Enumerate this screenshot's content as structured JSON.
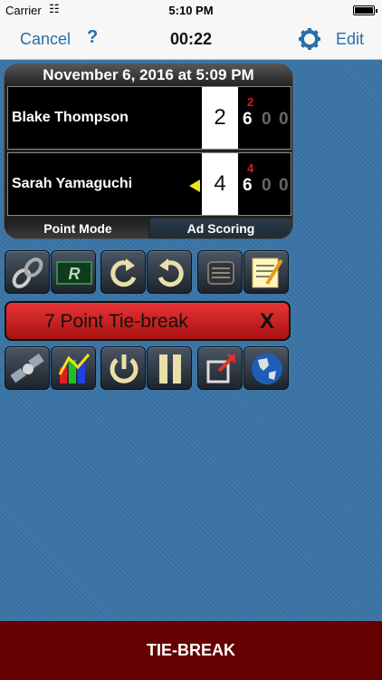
{
  "status_bar": {
    "carrier": "Carrier",
    "time": "5:10 PM"
  },
  "nav": {
    "cancel": "Cancel",
    "help": "?",
    "clock": "00:22",
    "edit": "Edit"
  },
  "board": {
    "date": "November 6, 2016 at 5:09 PM",
    "players": [
      {
        "name": "Blake Thompson",
        "points": "2",
        "tiebreak": "2",
        "games": [
          "6",
          "0",
          "0"
        ]
      },
      {
        "name": "Sarah Yamaguchi",
        "points": "4",
        "tiebreak": "4",
        "games": [
          "6",
          "0",
          "0"
        ]
      }
    ],
    "modes": [
      "Point Mode",
      "Ad Scoring"
    ]
  },
  "tools": {
    "row1": [
      "link-icon",
      "replay-icon",
      "undo-icon",
      "redo-icon",
      "menu-icon",
      "notes-icon"
    ],
    "row2": [
      "satellite-icon",
      "stats-chart-icon",
      "power-icon",
      "pause-icon",
      "export-icon",
      "globe-icon"
    ],
    "replay_letter": "R"
  },
  "tiebreak": {
    "label": "7 Point Tie-break",
    "close": "X"
  },
  "footer": {
    "label": "TIE-BREAK"
  },
  "colors": {
    "accent": "#2a6ea8",
    "tiebreak_red": "#d82020",
    "footer_bg": "#640000",
    "serve_indicator": "#e7e51a"
  }
}
